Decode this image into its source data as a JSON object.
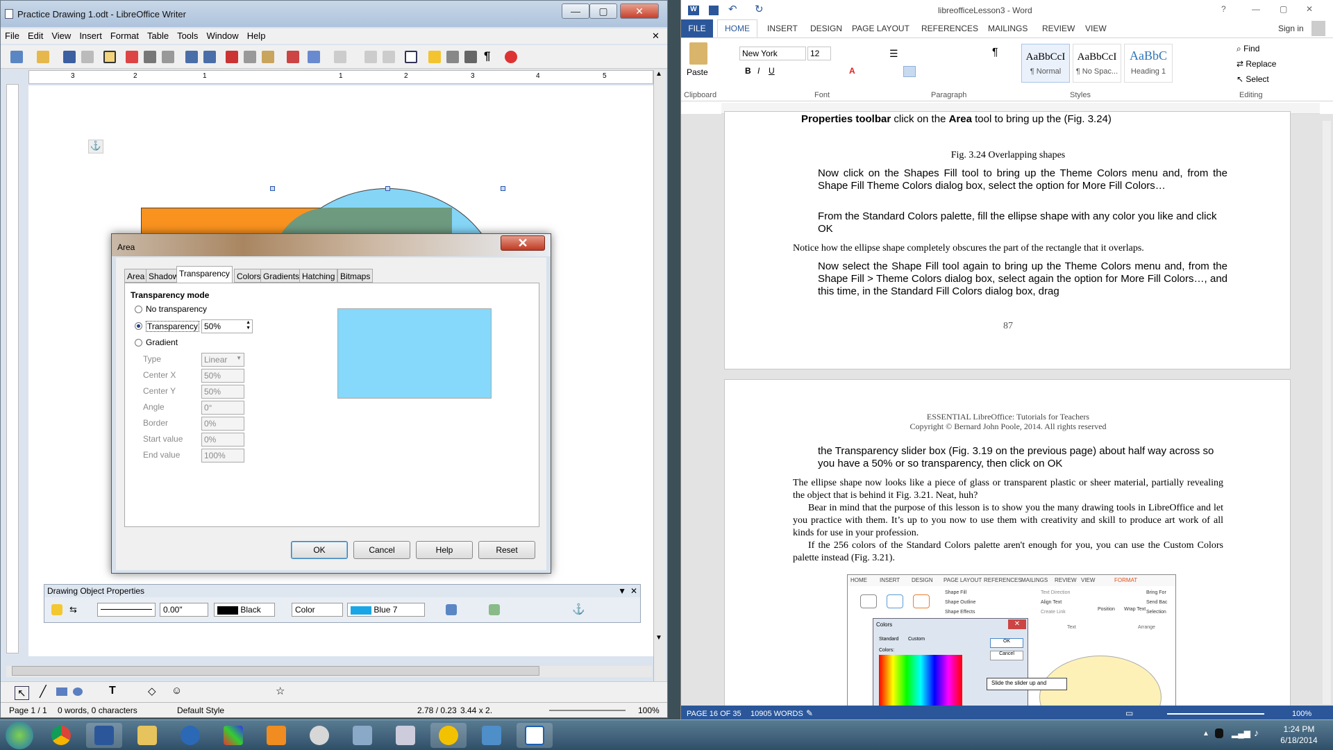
{
  "writer": {
    "title": "Practice Drawing 1.odt - LibreOffice Writer",
    "menu": [
      "File",
      "Edit",
      "View",
      "Insert",
      "Format",
      "Table",
      "Tools",
      "Window",
      "Help"
    ],
    "ruler_marks": [
      "3",
      "2",
      "1",
      "1",
      "2",
      "3",
      "4",
      "5"
    ],
    "drawing_props": {
      "title": "Drawing Object Properties",
      "line_width": "0.00\"",
      "line_color": "Black",
      "area_style": "Color",
      "area_color": "Blue 7"
    },
    "status": {
      "page": "Page 1 / 1",
      "words": "0 words, 0 characters",
      "style": "Default Style",
      "position": "2.78 / 0.23",
      "size": "3.44 x 2.",
      "zoom": "100%"
    }
  },
  "dialog": {
    "title": "Area",
    "tabs": [
      "Area",
      "Shadow",
      "Transparency",
      "Colors",
      "Gradients",
      "Hatching",
      "Bitmaps"
    ],
    "active_tab": "Transparency",
    "section": "Transparency mode",
    "no_transparency": "No transparency",
    "transparency": "Transparency",
    "transparency_value": "50%",
    "gradient": "Gradient",
    "fields": [
      {
        "label": "Type",
        "value": "Linear"
      },
      {
        "label": "Center X",
        "value": "50%"
      },
      {
        "label": "Center Y",
        "value": "50%"
      },
      {
        "label": "Angle",
        "value": "0°"
      },
      {
        "label": "Border",
        "value": "0%"
      },
      {
        "label": "Start value",
        "value": "0%"
      },
      {
        "label": "End value",
        "value": "100%"
      }
    ],
    "buttons": {
      "ok": "OK",
      "cancel": "Cancel",
      "help": "Help",
      "reset": "Reset"
    },
    "preview_color": "#86d9fa"
  },
  "word": {
    "title": "libreofficeLesson3 - Word",
    "signin": "Sign in",
    "tabs": [
      "FILE",
      "HOME",
      "INSERT",
      "DESIGN",
      "PAGE LAYOUT",
      "REFERENCES",
      "MAILINGS",
      "REVIEW",
      "VIEW"
    ],
    "font": "New York",
    "size": "12",
    "groups": {
      "clipboard": "Clipboard",
      "font": "Font",
      "paragraph": "Paragraph",
      "styles": "Styles",
      "editing": "Editing"
    },
    "paste": "Paste",
    "styles": [
      {
        "preview": "AaBbCcI",
        "name": "¶ Normal"
      },
      {
        "preview": "AaBbCcI",
        "name": "¶ No Spac..."
      },
      {
        "preview": "AaBbC",
        "name": "Heading 1"
      }
    ],
    "editing": [
      "Find",
      "Replace",
      "Select"
    ],
    "page1": {
      "top_line_a": "Properties toolbar",
      "top_line_b": " click on the ",
      "top_line_c": "Area",
      "top_line_d": " tool to bring up the (Fig. 3.24)",
      "caption": "Fig. 3.24 Overlapping shapes",
      "p1": "Now click on the Shapes Fill tool to bring up the Theme Colors menu and, from the Shape Fill Theme Colors dialog box, select the option for More Fill Colors…",
      "p2": "From the Standard Colors palette, fill the ellipse shape with any color you like and click OK",
      "p3": "Notice how the ellipse shape completely obscures the part of the rectangle that it overlaps.",
      "p4": "Now select the Shape Fill tool again to bring up the Theme Colors menu and, from the Shape Fill > Theme Colors dialog box, select again the option for More Fill Colors…, and this time, in the Standard Fill Colors dialog box, drag",
      "page_number": "87"
    },
    "page2": {
      "header1": "ESSENTIAL LibreOffice: Tutorials for Teachers",
      "header2": "Copyright © Bernard John Poole, 2014. All rights reserved",
      "p1": "the Transparency slider box (Fig. 3.19 on the previous page) about half way across so you have a 50% or so transparency, then click on OK",
      "p2": "The ellipse shape now looks like a piece of glass or transparent plastic or sheer material, partially revealing the object that is behind it Fig. 3.21. Neat, huh?",
      "p3": "Bear in mind that the purpose of this lesson is to show you the many drawing tools in LibreOffice and let you practice with them. It’s up to you now to use them with creativity and skill to produce art work of all kinds for use in your profession.",
      "p4": "If the 256 colors of the Standard Colors palette aren't enough for you, you can use the Custom Colors palette instead (Fig. 3.21).",
      "fig_tabs": [
        "HOME",
        "INSERT",
        "DESIGN",
        "PAGE LAYOUT",
        "REFERENCES",
        "MAILINGS",
        "REVIEW",
        "VIEW",
        "FORMAT"
      ],
      "fig_items": [
        "Shape Fill",
        "Shape Outline",
        "Shape Effects",
        "Text Direction",
        "Align Text",
        "Create Link",
        "Position",
        "Wrap Text",
        "Bring For",
        "Send Bac",
        "Selection"
      ],
      "fig_groups": [
        "Text",
        "Arrange"
      ],
      "fig_dialog_title": "Colors",
      "fig_dialog_tabs": [
        "Standard",
        "Custom"
      ],
      "fig_colors_label": "Colors:",
      "fig_ok": "OK",
      "fig_cancel": "Cancel",
      "fig_callout": "Slide the slider up and"
    },
    "status": {
      "page": "PAGE 16 OF 35",
      "words": "10905 WORDS",
      "zoom": "100%"
    }
  },
  "taskbar": {
    "time": "1:24 PM",
    "date": "6/18/2014"
  }
}
